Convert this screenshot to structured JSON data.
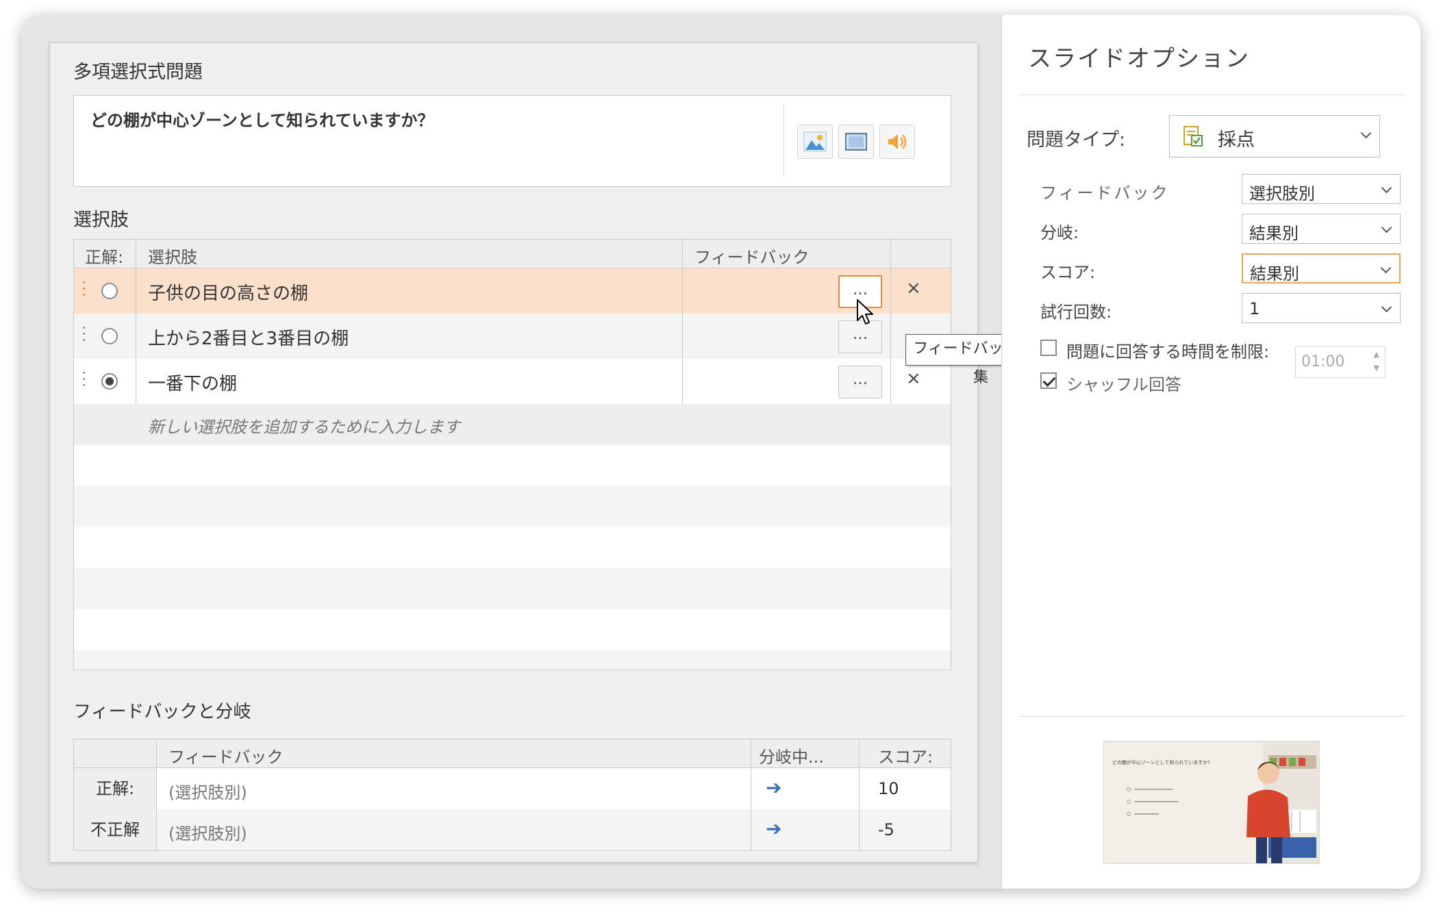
{
  "left": {
    "mc_title": "多項選択式問題",
    "question": "どの棚が中心ゾーンとして知られていますか？",
    "media": {
      "image": "image-icon",
      "video": "video-icon",
      "audio": "audio-icon"
    },
    "choices_title": "選択肢",
    "headers": {
      "correct": "正解:",
      "choice": "選択肢",
      "feedback": "フィードバック"
    },
    "choices": [
      {
        "text": "子供の目の高さの棚",
        "selected": false,
        "highlight": true,
        "more": "…",
        "delete": "×"
      },
      {
        "text": "上から2番目と3番目の棚",
        "selected": false,
        "highlight": false,
        "more": "…",
        "delete": ""
      },
      {
        "text": "一番下の棚",
        "selected": true,
        "highlight": false,
        "more": "…",
        "delete": "×"
      }
    ],
    "new_placeholder": "新しい選択肢を追加するために入力します",
    "tooltip": "フィードバックの編集",
    "fb_title": "フィードバックと分岐",
    "fb_headers": {
      "feedback": "フィードバック",
      "branch": "分岐中...",
      "score": "スコア:"
    },
    "fb_rows": [
      {
        "label": "正解:",
        "feedback": "(選択肢別)",
        "arrow": "➔",
        "score": "10"
      },
      {
        "label": "不正解",
        "feedback": "(選択肢別)",
        "arrow": "➔",
        "score": "-5"
      }
    ]
  },
  "right": {
    "title": "スライドオプション",
    "question_type_label": "問題タイプ:",
    "question_type_value": "採点",
    "feedback_label": "フィードバック",
    "feedback_value": "選択肢別",
    "branch_label": "分岐:",
    "branch_value": "結果別",
    "score_label": "スコア:",
    "score_value": "結果別",
    "attempts_label": "試行回数:",
    "attempts_value": "1",
    "time_limit_label": "問題に回答する時間を制限:",
    "time_limit_value": "01:00",
    "time_limit_checked": false,
    "shuffle_label": "シャッフル回答",
    "shuffle_checked": true,
    "thumb_question": "どの棚が中心ゾーンとして知られていますか?"
  },
  "colors": {
    "accent": "#e8883c",
    "highlight_row": "#fbe1cb",
    "arrow": "#3b6fb5"
  }
}
